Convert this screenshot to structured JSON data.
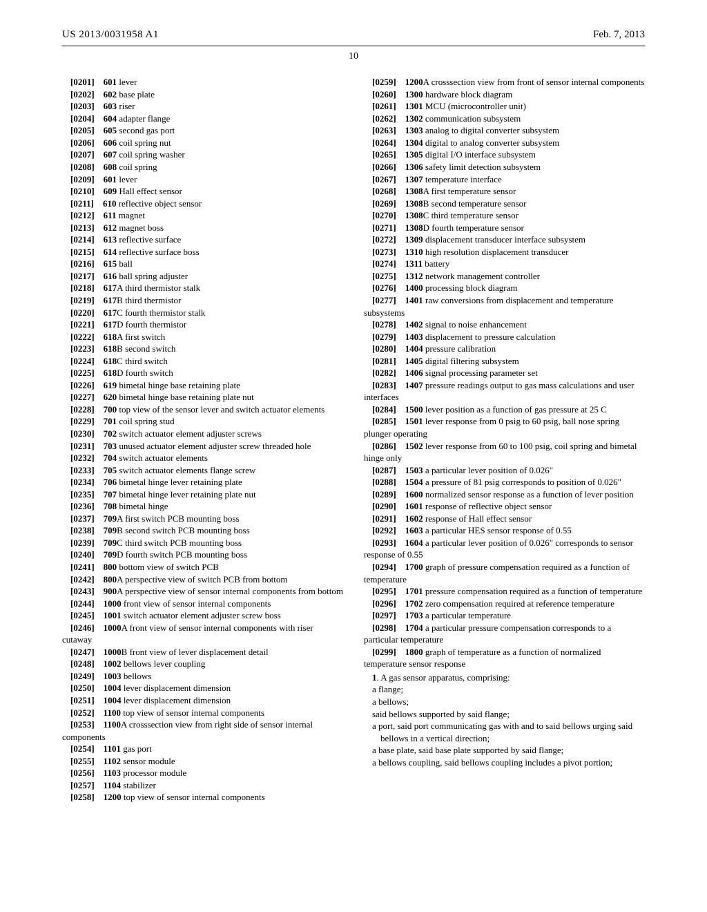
{
  "header": {
    "left": "US 2013/0031958 A1",
    "right": "Feb. 7, 2013"
  },
  "page_number": "10",
  "left_column": [
    {
      "p": "[0201]",
      "r": "601",
      "t": " lever"
    },
    {
      "p": "[0202]",
      "r": "602",
      "t": " base plate"
    },
    {
      "p": "[0203]",
      "r": "603",
      "t": " riser"
    },
    {
      "p": "[0204]",
      "r": "604",
      "t": " adapter flange"
    },
    {
      "p": "[0205]",
      "r": "605",
      "t": " second gas port"
    },
    {
      "p": "[0206]",
      "r": "606",
      "t": " coil spring nut"
    },
    {
      "p": "[0207]",
      "r": "607",
      "t": " coil spring washer"
    },
    {
      "p": "[0208]",
      "r": "608",
      "t": " coil spring"
    },
    {
      "p": "[0209]",
      "r": "601",
      "t": " lever"
    },
    {
      "p": "[0210]",
      "r": "609",
      "t": " Hall effect sensor"
    },
    {
      "p": "[0211]",
      "r": "610",
      "t": " reflective object sensor"
    },
    {
      "p": "[0212]",
      "r": "611",
      "t": " magnet"
    },
    {
      "p": "[0213]",
      "r": "612",
      "t": " magnet boss"
    },
    {
      "p": "[0214]",
      "r": "613",
      "t": " reflective surface"
    },
    {
      "p": "[0215]",
      "r": "614",
      "t": " reflective surface boss"
    },
    {
      "p": "[0216]",
      "r": "615",
      "t": " ball"
    },
    {
      "p": "[0217]",
      "r": "616",
      "t": " ball spring adjuster"
    },
    {
      "p": "[0218]",
      "r": "617",
      "t": "A third thermistor stalk"
    },
    {
      "p": "[0219]",
      "r": "617",
      "t": "B third thermistor"
    },
    {
      "p": "[0220]",
      "r": "617",
      "t": "C fourth thermistor stalk"
    },
    {
      "p": "[0221]",
      "r": "617",
      "t": "D fourth thermistor"
    },
    {
      "p": "[0222]",
      "r": "618",
      "t": "A first switch"
    },
    {
      "p": "[0223]",
      "r": "618",
      "t": "B second switch"
    },
    {
      "p": "[0224]",
      "r": "618",
      "t": "C third switch"
    },
    {
      "p": "[0225]",
      "r": "618",
      "t": "D fourth switch"
    },
    {
      "p": "[0226]",
      "r": "619",
      "t": " bimetal hinge base retaining plate"
    },
    {
      "p": "[0227]",
      "r": "620",
      "t": " bimetal hinge base retaining plate nut"
    },
    {
      "p": "[0228]",
      "r": "700",
      "t": " top view of the sensor lever and switch actuator elements",
      "wrap": true,
      "cont": "elements"
    },
    {
      "p": "[0229]",
      "r": "701",
      "t": " coil spring stud"
    },
    {
      "p": "[0230]",
      "r": "702",
      "t": " switch actuator element adjuster screws"
    },
    {
      "p": "[0231]",
      "r": "703",
      "t": " unused actuator element adjuster screw threaded hole",
      "wrap": true,
      "cont": "threaded hole"
    },
    {
      "p": "[0232]",
      "r": "704",
      "t": " switch actuator elements"
    },
    {
      "p": "[0233]",
      "r": "705",
      "t": " switch actuator elements flange screw"
    },
    {
      "p": "[0234]",
      "r": "706",
      "t": " bimetal hinge lever retaining plate"
    },
    {
      "p": "[0235]",
      "r": "707",
      "t": " bimetal hinge lever retaining plate nut"
    },
    {
      "p": "[0236]",
      "r": "708",
      "t": " bimetal hinge"
    },
    {
      "p": "[0237]",
      "r": "709",
      "t": "A first switch PCB mounting boss"
    },
    {
      "p": "[0238]",
      "r": "709",
      "t": "B second switch PCB mounting boss"
    },
    {
      "p": "[0239]",
      "r": "709",
      "t": "C third switch PCB mounting boss"
    },
    {
      "p": "[0240]",
      "r": "709",
      "t": "D fourth switch PCB mounting boss"
    },
    {
      "p": "[0241]",
      "r": "800",
      "t": " bottom view of switch PCB"
    },
    {
      "p": "[0242]",
      "r": "800",
      "t": "A perspective view of switch PCB from bottom"
    },
    {
      "p": "[0243]",
      "r": "900",
      "t": "A perspective view of sensor internal components from bottom",
      "wrap": true,
      "cont": "nents from bottom"
    },
    {
      "p": "[0244]",
      "r": "1000",
      "t": " front view of sensor internal components"
    },
    {
      "p": "[0245]",
      "r": "1001",
      "t": " switch actuator element adjuster screw boss"
    },
    {
      "p": "[0246]",
      "r": "1000",
      "t": "A front view of sensor internal components with riser cutaway",
      "wrap": true,
      "cont": "with riser cutaway"
    },
    {
      "p": "[0247]",
      "r": "1000",
      "t": "B front view of lever displacement detail"
    },
    {
      "p": "[0248]",
      "r": "1002",
      "t": " bellows lever coupling"
    },
    {
      "p": "[0249]",
      "r": "1003",
      "t": " bellows"
    },
    {
      "p": "[0250]",
      "r": "1004",
      "t": " lever displacement dimension"
    },
    {
      "p": "[0251]",
      "r": "1004",
      "t": " lever displacement dimension"
    },
    {
      "p": "[0252]",
      "r": "1100",
      "t": " top view of sensor internal components"
    },
    {
      "p": "[0253]",
      "r": "1100",
      "t": "A crosssection view from right side of sensor internal components",
      "wrap": true,
      "cont": "internal components"
    },
    {
      "p": "[0254]",
      "r": "1101",
      "t": " gas port"
    },
    {
      "p": "[0255]",
      "r": "1102",
      "t": " sensor module"
    },
    {
      "p": "[0256]",
      "r": "1103",
      "t": " processor module"
    },
    {
      "p": "[0257]",
      "r": "1104",
      "t": " stabilizer"
    },
    {
      "p": "[0258]",
      "r": "1200",
      "t": " top view of sensor internal components"
    }
  ],
  "right_column": [
    {
      "p": "[0259]",
      "r": "1200",
      "t": "A crosssection view from front of sensor internal components",
      "wrap": true,
      "cont": "nal components"
    },
    {
      "p": "[0260]",
      "r": "1300",
      "t": " hardware block diagram"
    },
    {
      "p": "[0261]",
      "r": "1301",
      "t": " MCU (microcontroller unit)"
    },
    {
      "p": "[0262]",
      "r": "1302",
      "t": " communication subsystem"
    },
    {
      "p": "[0263]",
      "r": "1303",
      "t": " analog to digital converter subsystem"
    },
    {
      "p": "[0264]",
      "r": "1304",
      "t": " digital to analog converter subsystem"
    },
    {
      "p": "[0265]",
      "r": "1305",
      "t": " digital I/O interface subsystem"
    },
    {
      "p": "[0266]",
      "r": "1306",
      "t": " safety limit detection subsystem"
    },
    {
      "p": "[0267]",
      "r": "1307",
      "t": " temperature interface"
    },
    {
      "p": "[0268]",
      "r": "1308",
      "t": "A first temperature sensor"
    },
    {
      "p": "[0269]",
      "r": "1308",
      "t": "B second temperature sensor"
    },
    {
      "p": "[0270]",
      "r": "1308",
      "t": "C third temperature sensor"
    },
    {
      "p": "[0271]",
      "r": "1308",
      "t": "D fourth temperature sensor"
    },
    {
      "p": "[0272]",
      "r": "1309",
      "t": " displacement transducer interface subsystem"
    },
    {
      "p": "[0273]",
      "r": "1310",
      "t": " high resolution displacement transducer"
    },
    {
      "p": "[0274]",
      "r": "1311",
      "t": " battery"
    },
    {
      "p": "[0275]",
      "r": "1312",
      "t": " network management controller"
    },
    {
      "p": "[0276]",
      "r": "1400",
      "t": " processing block diagram"
    },
    {
      "p": "[0277]",
      "r": "1401",
      "t": " raw conversions from displacement and temperature subsystems",
      "wrap": true,
      "cont": "perature subsystems"
    },
    {
      "p": "[0278]",
      "r": "1402",
      "t": " signal to noise enhancement"
    },
    {
      "p": "[0279]",
      "r": "1403",
      "t": " displacement to pressure calculation"
    },
    {
      "p": "[0280]",
      "r": "1404",
      "t": " pressure calibration"
    },
    {
      "p": "[0281]",
      "r": "1405",
      "t": " digital filtering subsystem"
    },
    {
      "p": "[0282]",
      "r": "1406",
      "t": " signal processing parameter set"
    },
    {
      "p": "[0283]",
      "r": "1407",
      "t": " pressure readings output to gas mass calculations and user interfaces",
      "wrap": true,
      "cont": "tions and user interfaces"
    },
    {
      "p": "[0284]",
      "r": "1500",
      "t": " lever position as a function of gas pressure at 25 C",
      "wrap": true,
      "cont": "25 C"
    },
    {
      "p": "[0285]",
      "r": "1501",
      "t": " lever response from 0 psig to 60 psig, ball nose spring plunger operating",
      "wrap": true,
      "cont": "spring plunger operating"
    },
    {
      "p": "[0286]",
      "r": "1502",
      "t": " lever response from 60 to 100 psig, coil spring and bimetal hinge only",
      "wrap": true,
      "cont": "and bimetal hinge only"
    },
    {
      "p": "[0287]",
      "r": "1503",
      "t": " a particular lever position of 0.026\""
    },
    {
      "p": "[0288]",
      "r": "1504",
      "t": " a pressure of 81 psig corresponds to position of 0.026\"",
      "wrap": true,
      "cont": "0.026\""
    },
    {
      "p": "[0289]",
      "r": "1600",
      "t": " normalized sensor response as a function of lever position",
      "wrap": true,
      "cont": "lever position"
    },
    {
      "p": "[0290]",
      "r": "1601",
      "t": " response of reflective object sensor"
    },
    {
      "p": "[0291]",
      "r": "1602",
      "t": " response of Hall effect sensor"
    },
    {
      "p": "[0292]",
      "r": "1603",
      "t": " a particular HES sensor response of 0.55"
    },
    {
      "p": "[0293]",
      "r": "1604",
      "t": " a particular lever position of 0.026\" corresponds to sensor response of 0.55",
      "wrap": true,
      "cont": "sponds to sensor response of 0.55"
    },
    {
      "p": "[0294]",
      "r": "1700",
      "t": " graph of pressure compensation required as a function of temperature",
      "wrap": true,
      "cont": "function of temperature"
    },
    {
      "p": "[0295]",
      "r": "1701",
      "t": " pressure compensation required as a function of temperature",
      "wrap": true,
      "cont": "of temperature"
    },
    {
      "p": "[0296]",
      "r": "1702",
      "t": " zero compensation required at reference temperature",
      "wrap": true,
      "cont": "perature"
    },
    {
      "p": "[0297]",
      "r": "1703",
      "t": " a particular temperature"
    },
    {
      "p": "[0298]",
      "r": "1704",
      "t": " a particular pressure compensation corresponds to a particular temperature",
      "wrap": true,
      "cont": "sponds to a particular temperature"
    },
    {
      "p": "[0299]",
      "r": "1800",
      "t": " graph of temperature as a function of normalized temperature sensor response",
      "wrap": true,
      "cont": "ized temperature sensor response"
    }
  ],
  "claims": {
    "lead": "1",
    "lead_text": ". A gas sensor apparatus, comprising:",
    "lines": [
      "a flange;",
      "a bellows;",
      "said bellows supported by said flange;",
      "a port, said port communicating gas with and to said bellows urging said bellows in a vertical direction;",
      "a base plate, said base plate supported by said flange;",
      "a bellows coupling, said bellows coupling includes a pivot portion;"
    ]
  }
}
